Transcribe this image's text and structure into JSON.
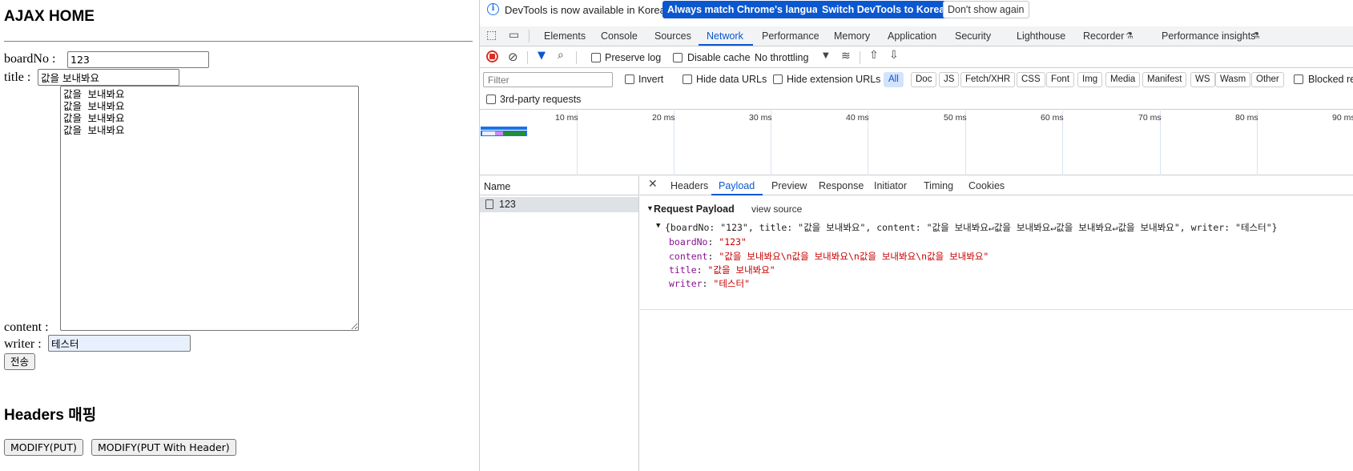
{
  "page": {
    "title": "AJAX HOME",
    "form": {
      "boardNo_label": "boardNo :",
      "boardNo_value": "123",
      "title_label": "title :",
      "title_value": "값을 보내봐요",
      "content_label": "content :",
      "content_value": "값을 보내봐요\n값을 보내봐요\n값을 보내봐요\n값을 보내봐요",
      "writer_label": "writer :",
      "writer_value": "테스터",
      "submit_label": "전송"
    },
    "headers_title": "Headers 매핑",
    "buttons": {
      "modify_put": "MODIFY(PUT)",
      "modify_put_header": "MODIFY(PUT With Header)"
    }
  },
  "devtools": {
    "infobar": {
      "message": "DevTools is now available in Korean!",
      "match_language": "Always match Chrome's language",
      "switch_korean": "Switch DevTools to Korean",
      "dont_show": "Don't show again"
    },
    "tabs": [
      "Elements",
      "Console",
      "Sources",
      "Network",
      "Performance",
      "Memory",
      "Application",
      "Security",
      "Lighthouse",
      "Recorder",
      "Performance insights"
    ],
    "active_tab": "Network",
    "toolbar": {
      "preserve_log": "Preserve log",
      "disable_cache": "Disable cache",
      "throttling": "No throttling"
    },
    "filter": {
      "placeholder": "Filter",
      "invert": "Invert",
      "hide_data_urls": "Hide data URLs",
      "hide_extension_urls": "Hide extension URLs",
      "types": [
        "All",
        "Doc",
        "JS",
        "Fetch/XHR",
        "CSS",
        "Font",
        "Img",
        "Media",
        "Manifest",
        "WS",
        "Wasm",
        "Other"
      ],
      "active_type": "All",
      "blocked": "Blocked re",
      "third_party": "3rd-party requests"
    },
    "timeline_ticks": [
      "10 ms",
      "20 ms",
      "30 ms",
      "40 ms",
      "50 ms",
      "60 ms",
      "70 ms",
      "80 ms",
      "90 ms"
    ],
    "requests": {
      "header": "Name",
      "rows": [
        "123"
      ]
    },
    "detail_tabs": [
      "Headers",
      "Payload",
      "Preview",
      "Response",
      "Initiator",
      "Timing",
      "Cookies"
    ],
    "active_detail_tab": "Payload",
    "payload": {
      "title": "Request Payload",
      "view_source": "view source",
      "summary": "{boardNo: \"123\", title: \"값을 보내봐요\", content: \"값을 보내봐요↵값을 보내봐요↵값을 보내봐요↵값을 보내봐요\", writer: \"테스터\"}",
      "props": [
        {
          "key": "boardNo",
          "value": "\"123\""
        },
        {
          "key": "content",
          "value": "\"값을 보내봐요\\n값을 보내봐요\\n값을 보내봐요\\n값을 보내봐요\""
        },
        {
          "key": "title",
          "value": "\"값을 보내봐요\""
        },
        {
          "key": "writer",
          "value": "\"테스터\""
        }
      ]
    }
  }
}
